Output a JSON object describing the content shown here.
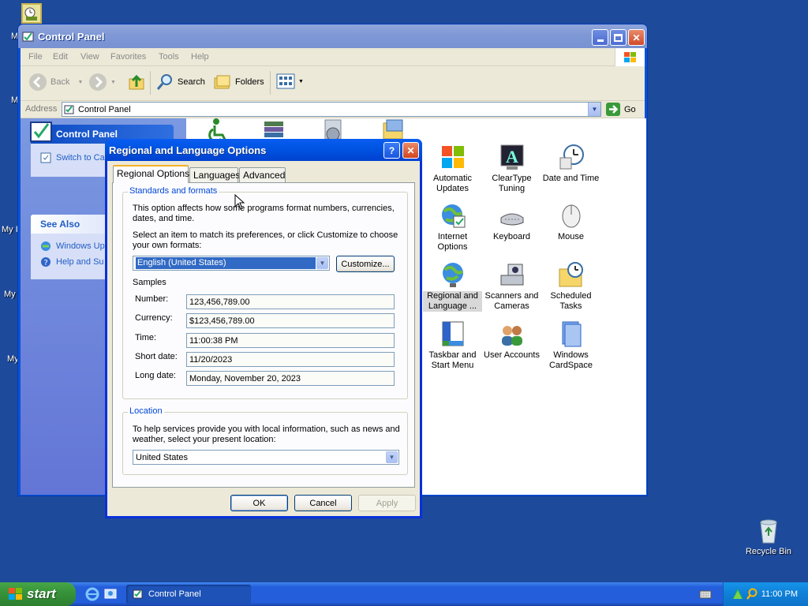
{
  "desktop": {
    "left_labels": [
      "M",
      "M",
      "My I",
      "My",
      "My"
    ],
    "recycle_bin_label": "Recycle Bin"
  },
  "control_panel": {
    "title": "Control Panel",
    "menu": [
      "File",
      "Edit",
      "View",
      "Favorites",
      "Tools",
      "Help"
    ],
    "toolbar": {
      "back_label": "Back",
      "search_label": "Search",
      "folders_label": "Folders"
    },
    "address_label": "Address",
    "address_value": "Control Panel",
    "go_label": "Go",
    "left_panel": {
      "header": "Control Panel",
      "switch_link": "Switch to Ca",
      "see_also": "See Also",
      "links": [
        "Windows Up",
        "Help and Su"
      ]
    },
    "items": [
      {
        "label": "Automatic Updates"
      },
      {
        "label": "ClearType Tuning"
      },
      {
        "label": "Date and Time"
      },
      {
        "label": "Internet Options"
      },
      {
        "label": "Keyboard"
      },
      {
        "label": "Mouse"
      },
      {
        "label": "Regional and Language ..."
      },
      {
        "label": "Scanners and Cameras"
      },
      {
        "label": "Scheduled Tasks"
      },
      {
        "label": "Taskbar and Start Menu"
      },
      {
        "label": "User Accounts"
      },
      {
        "label": "Windows CardSpace"
      }
    ]
  },
  "dialog": {
    "title": "Regional and Language Options",
    "help_btn": "?",
    "tabs": [
      "Regional Options",
      "Languages",
      "Advanced"
    ],
    "standards": {
      "group_title": "Standards and formats",
      "desc": "This option affects how some programs format numbers, currencies, dates, and time.",
      "select_desc": "Select an item to match its preferences, or click Customize to choose your own formats:",
      "format_value": "English (United States)",
      "customize_label": "Customize...",
      "samples_label": "Samples",
      "samples": [
        {
          "label": "Number:",
          "value": "123,456,789.00"
        },
        {
          "label": "Currency:",
          "value": "$123,456,789.00"
        },
        {
          "label": "Time:",
          "value": "11:00:38 PM"
        },
        {
          "label": "Short date:",
          "value": "11/20/2023"
        },
        {
          "label": "Long date:",
          "value": "Monday, November 20, 2023"
        }
      ]
    },
    "location": {
      "group_title": "Location",
      "desc": "To help services provide you with local information, such as news and weather, select your present location:",
      "value": "United States"
    },
    "ok_label": "OK",
    "cancel_label": "Cancel",
    "apply_label": "Apply"
  },
  "taskbar": {
    "start_label": "start",
    "task_label": "Control Panel",
    "clock": "11:00 PM"
  }
}
